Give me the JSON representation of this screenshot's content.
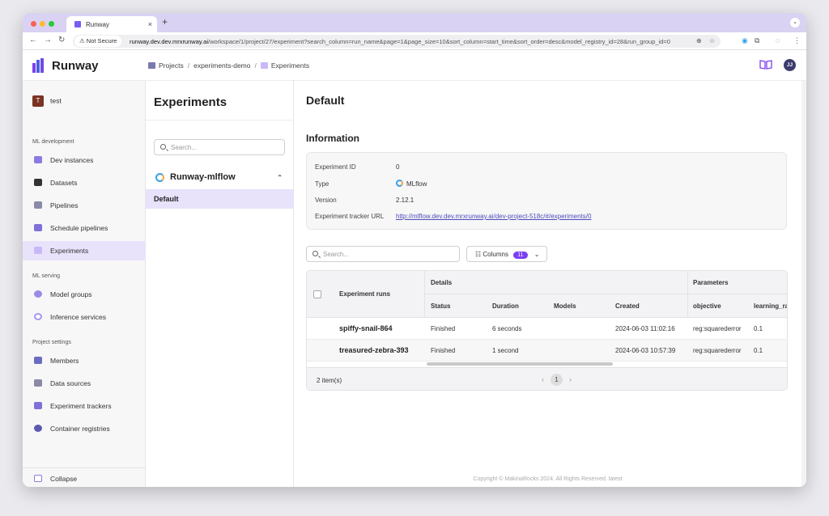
{
  "browser": {
    "tab_title": "Runway",
    "new_tab": "+",
    "tab_close": "×",
    "not_secure": "⚠ Not Secure",
    "url_host": "runway.dev.dev.mrxrunway.ai",
    "url_path": "/workspace/1/project/27/experiment?search_column=run_name&page=1&page_size=10&sort_column=start_time&sort_order=desc&model_registry_id=28&run_group_id=0",
    "colors": {
      "tabbar": "#d9d2f2",
      "close": "#ff5f57",
      "min": "#febc2e",
      "max": "#28c840"
    }
  },
  "header": {
    "logo": "Runway",
    "breadcrumb": {
      "projects": "Projects",
      "project": "experiments-demo",
      "current": "Experiments"
    },
    "avatar": "JJ"
  },
  "sidebar": {
    "workspace_initial": "T",
    "workspace_name": "test",
    "sections": {
      "ml_dev": "ML development",
      "ml_serving": "ML serving",
      "project_settings": "Project settings"
    },
    "items": {
      "dev_instances": "Dev instances",
      "datasets": "Datasets",
      "pipelines": "Pipelines",
      "schedule_pipelines": "Schedule pipelines",
      "experiments": "Experiments",
      "model_groups": "Model groups",
      "inference_services": "Inference services",
      "members": "Members",
      "data_sources": "Data sources",
      "experiment_trackers": "Experiment trackers",
      "container_registries": "Container registries"
    },
    "collapse": "Collapse",
    "accent": "#7b3ff2"
  },
  "experiments_panel": {
    "title": "Experiments",
    "search_placeholder": "Search...",
    "group_name": "Runway-mlflow",
    "selected": "Default"
  },
  "main": {
    "title": "Default",
    "info_title": "Information",
    "info": {
      "id_label": "Experiment ID",
      "id_value": "0",
      "type_label": "Type",
      "type_value": "MLflow",
      "version_label": "Version",
      "version_value": "2.12.1",
      "url_label": "Experiment tracker URL",
      "url_value": "http://mlflow.dev.dev.mrxrunway.ai/dev-project-518c/#/experiments/0"
    },
    "runs_search_placeholder": "Search...",
    "columns_label": "Columns",
    "columns_count": "11",
    "table": {
      "runs_header": "Experiment runs",
      "group_details": "Details",
      "group_parameters": "Parameters",
      "headers": {
        "status": "Status",
        "duration": "Duration",
        "models": "Models",
        "created": "Created",
        "objective": "objective",
        "learning_rate": "learning_ra"
      },
      "rows": [
        {
          "run": "spiffy-snail-864",
          "status": "Finished",
          "duration": "6 seconds",
          "models": "",
          "created": "2024-06-03 11:02:16",
          "objective": "reg:squarederror",
          "lr": "0.1"
        },
        {
          "run": "treasured-zebra-393",
          "status": "Finished",
          "duration": "1 second",
          "models": "",
          "created": "2024-06-03 10:57:39",
          "objective": "reg:squarederror",
          "lr": "0.1"
        }
      ],
      "count": "2 item(s)",
      "page": "1"
    },
    "copyright": "Copyright © MakinaRocks 2024. All Rights Reserved. latest"
  }
}
